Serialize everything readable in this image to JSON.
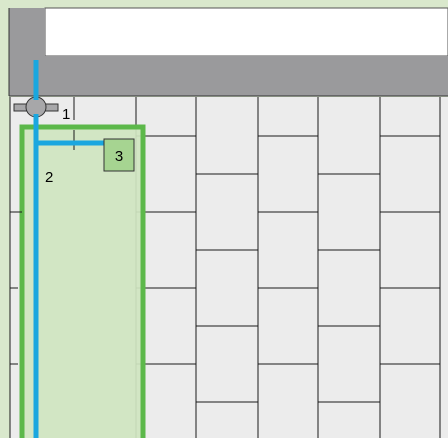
{
  "labels": {
    "marker_1": "1",
    "marker_2": "2",
    "marker_3": "3"
  },
  "colors": {
    "outer_background": "#d9e8cc",
    "wall": "#9a9a9c",
    "tile_area": "#ececec",
    "tile_line": "#1a1a1a",
    "highlight_fill": "#cfe5c0",
    "highlight_border": "#5cb84a",
    "pipe": "#1aa7df",
    "valve": "#a7a7a9",
    "box_fill": "#a6d491"
  },
  "icons": {
    "valve": "pipe-valve-icon"
  }
}
